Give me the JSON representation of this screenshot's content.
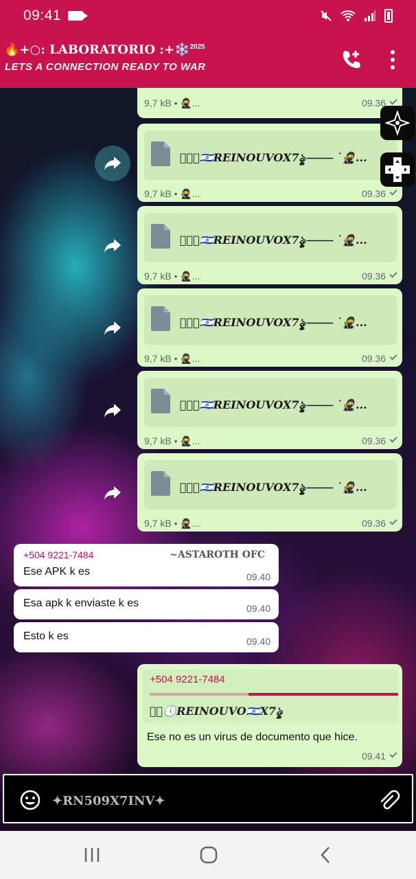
{
  "status_bar": {
    "time": "09:41"
  },
  "header": {
    "title": "🔥+○: LABORATORIO :+❄️",
    "title_sup": "2025",
    "subtitle": "LETS A CONNECTION READY TO WAR",
    "call_icon": "add-call-icon",
    "menu_icon": "more-vert-icon"
  },
  "messages": {
    "top_partial": {
      "size": "9,7 kB •",
      "sender_mark": "🥷...",
      "time": "09.36"
    },
    "docs": [
      {
        "name": "⸻✪ৢ🇮🇱REINOUVOX7ৡৢ⸻ ˙🥷...",
        "size": "9,7 kB •",
        "sender_mark": "🥷...",
        "time": "09.36"
      },
      {
        "name": "⸻✪ৢ🇮🇱REINOUVOX7ৡৢ⸻ ˙🥷...",
        "size": "9,7 kB •",
        "sender_mark": "🥷...",
        "time": "09.36"
      },
      {
        "name": "⸻✪ৢ🇮🇱REINOUVOX7ৡৢ⸻ ˙🥷...",
        "size": "9,7 kB •",
        "sender_mark": "🥷...",
        "time": "09.36"
      },
      {
        "name": "⸻✪ৢ🇮🇱REINOUVOX7ৡৢ⸻ ˙🥷...",
        "size": "9,7 kB •",
        "sender_mark": "🥷...",
        "time": "09.36"
      },
      {
        "name": "⸻✪ৢ🇮🇱REINOUVOX7ৡৢ⸻ ˙🥷...",
        "size": "9,7 kB •",
        "sender_mark": "🥷...",
        "time": "09.36"
      }
    ],
    "incoming": [
      {
        "sender": "+504 9221-7484",
        "pushname": "~ASTAROTH OFC",
        "text": "Ese APK k es",
        "time": "09.40"
      },
      {
        "text": "Esa apk k enviaste k es",
        "time": "09.40"
      },
      {
        "text": "Esto k es",
        "time": "09.40"
      }
    ],
    "reply": {
      "quoted_sender": "+504 9221-7484",
      "quoted_name": "⸻ৢ🕔REINOUVO🇮🇱X7ৡৢ",
      "text": "Ese no es un virus de documento que hice.",
      "time": "09.41"
    }
  },
  "input": {
    "value": "✦RN509X7INV✦",
    "emoji_icon": "emoji-icon",
    "attach_icon": "attach-icon"
  },
  "colors": {
    "accent": "#c8134f",
    "outgoing_bubble": "#dcf8c6",
    "incoming_bubble": "#ffffff"
  }
}
